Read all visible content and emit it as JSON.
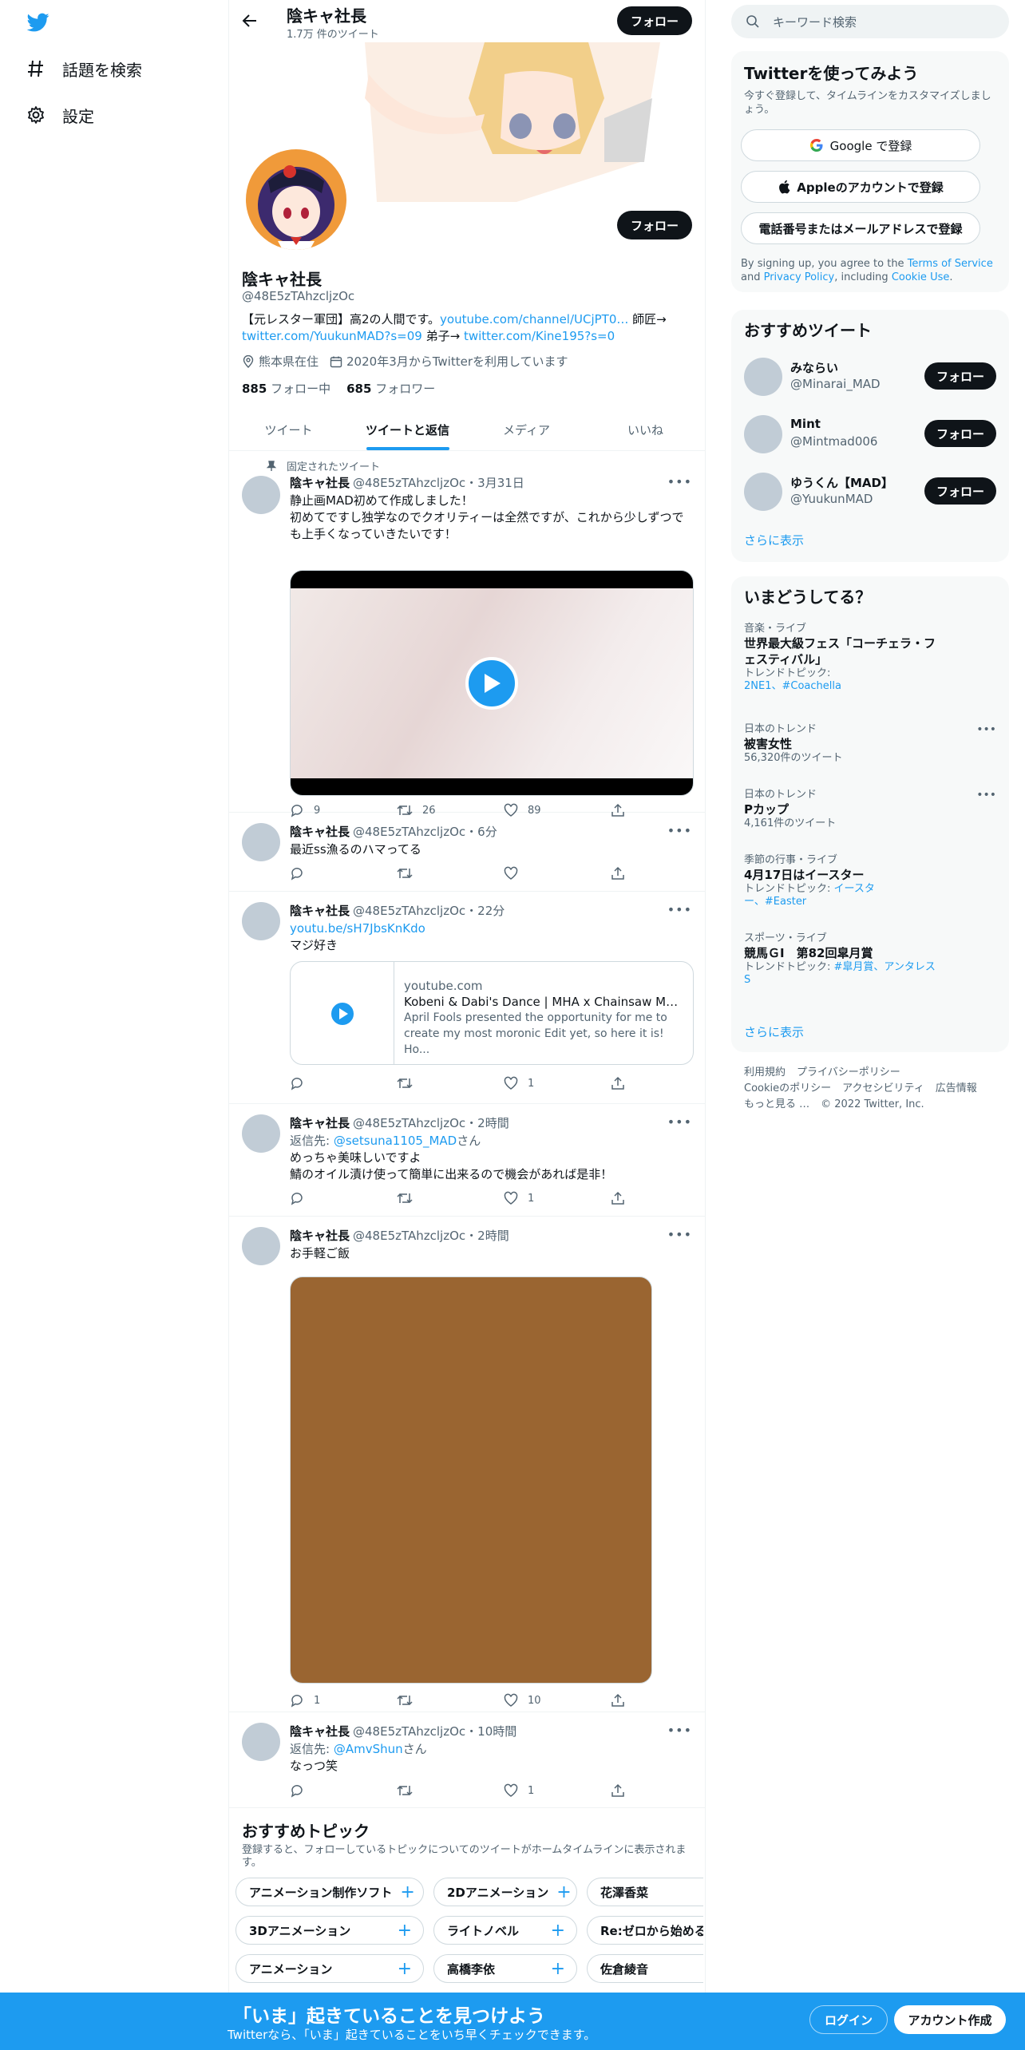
{
  "nav": {
    "explore_label": "話題を検索",
    "settings_label": "設定"
  },
  "header": {
    "name": "陰キャ社長",
    "tweet_count": "1.7万 件のツイート",
    "follow_label": "フォロー"
  },
  "profile": {
    "name": "陰キャ社長",
    "handle": "@48E5zTAhzcljzOc",
    "follow_label": "フォロー",
    "bio_text1": "【元レスター軍団】高2の人間です。",
    "bio_link1": "youtube.com/channel/UCjPT0…",
    "bio_text2": " 師匠→",
    "bio_link2": "twitter.com/YuukunMAD?s=09",
    "bio_text3": " 弟子→ ",
    "bio_link3": "twitter.com/Kine195?s=0",
    "location": "熊本県在住",
    "joined": "2020年3月からTwitterを利用しています",
    "following_count": "885",
    "following_label": "フォロー中",
    "followers_count": "685",
    "followers_label": "フォロワー"
  },
  "tabs": [
    "ツイート",
    "ツイートと返信",
    "メディア",
    "いいね"
  ],
  "tweets": [
    {
      "pinned_label": "固定されたツイート",
      "name": "陰キャ社長",
      "meta": "@48E5zTAhzcljzOc・3月31日",
      "text": "静止画MAD初めて作成しました！\n初めてですし独学なのでクオリティーは全然ですが、これから少しずつでも上手くなっていきたいです！",
      "replies": "9",
      "retweets": "26",
      "likes": "89"
    },
    {
      "name": "陰キャ社長",
      "meta": "@48E5zTAhzcljzOc・6分",
      "text": "最近ss漁るのハマってる",
      "replies": "",
      "retweets": "",
      "likes": ""
    },
    {
      "name": "陰キャ社長",
      "meta": "@48E5zTAhzcljzOc・22分",
      "link": "youtu.be/sH7JbsKnKdo",
      "text": "マジ好き",
      "card_domain": "youtube.com",
      "card_title": "Kobeni & Dabi's Dance | MHA x Chainsaw Man x ...",
      "card_desc": "April Fools presented the opportunity for me to create my most moronic Edit yet, so here it is! Ho...",
      "replies": "",
      "retweets": "",
      "likes": "1"
    },
    {
      "name": "陰キャ社長",
      "meta": "@48E5zTAhzcljzOc・2時間",
      "reply_to_label": "返信先: ",
      "reply_to": "@setsuna1105_MAD",
      "reply_suffix": "さん",
      "text": "めっちゃ美味しいですよ\n鯖のオイル漬け使って簡単に出来るので機会があれば是非！",
      "replies": "",
      "retweets": "",
      "likes": "1"
    },
    {
      "name": "陰キャ社長",
      "meta": "@48E5zTAhzcljzOc・2時間",
      "text": "お手軽ご飯",
      "replies": "1",
      "retweets": "",
      "likes": "10"
    },
    {
      "name": "陰キャ社長",
      "meta": "@48E5zTAhzcljzOc・10時間",
      "reply_to_label": "返信先: ",
      "reply_to": "@AmvShun",
      "reply_suffix": "さん",
      "text": "なっつ笑",
      "replies": "",
      "retweets": "",
      "likes": "1"
    }
  ],
  "topics": {
    "title": "おすすめトピック",
    "subtitle": "登録すると、フォローしているトピックについてのツイートがホームタイムラインに表示されます。",
    "rows": [
      [
        "アニメーション制作ソフト",
        "2Dアニメーション",
        "花澤香菜"
      ],
      [
        "3Dアニメーション",
        "ライトノベル",
        "Re:ゼロから始める"
      ],
      [
        "アニメーション",
        "高橋李依",
        "佐倉綾音"
      ]
    ]
  },
  "search": {
    "placeholder": "キーワード検索"
  },
  "signup": {
    "title": "Twitterを使ってみよう",
    "subtitle": "今すぐ登録して、タイムラインをカスタマイズしましょう。",
    "google": "Google で登録",
    "apple": "Appleのアカウントで登録",
    "phone": "電話番号またはメールアドレスで登録",
    "terms_1": "By signing up, you agree to the ",
    "terms_link1": "Terms of Service",
    "terms_2": " and ",
    "terms_link2": "Privacy Policy",
    "terms_3": ", including ",
    "terms_link3": "Cookie Use",
    "terms_4": "."
  },
  "suggest": {
    "title": "おすすめツイート",
    "users": [
      {
        "name": "みならい",
        "handle": "@Minarai_MAD"
      },
      {
        "name": "Mint",
        "handle": "@Mintmad006"
      },
      {
        "name": "ゆうくん【MAD】",
        "handle": "@YuukunMAD"
      }
    ],
    "follow_label": "フォロー",
    "more": "さらに表示"
  },
  "trends": {
    "title": "いまどうしてる？",
    "items": [
      {
        "cat": "音楽・ライブ",
        "title": "世界最大級フェス「コーチェラ・フェスティバル」",
        "sub_label": "トレンドトピック: ",
        "sub_links": "2NE1、#Coachella"
      },
      {
        "cat": "日本のトレンド",
        "title": "被害女性",
        "sub": "56,320件のツイート"
      },
      {
        "cat": "日本のトレンド",
        "title": "Pカップ",
        "sub": "4,161件のツイート"
      },
      {
        "cat": "季節の行事・ライブ",
        "title": "4月17日はイースター",
        "sub_label": "トレンドトピック: ",
        "sub_links": "イースター、#Easter"
      },
      {
        "cat": "スポーツ・ライブ",
        "title": "競馬ＧⅠ　第82回皐月賞",
        "sub_label": "トレンドトピック: ",
        "sub_links": "#皐月賞、アンタレスS"
      }
    ],
    "more": "さらに表示"
  },
  "footer": {
    "l1": "利用規約",
    "l2": "プライバシーポリシー",
    "l3": "Cookieのポリシー",
    "l4": "アクセシビリティ",
    "l5": "広告情報",
    "l6": "もっと見る …",
    "l7": "© 2022 Twitter, Inc."
  },
  "bottom": {
    "title": "「いま」起きていることを見つけよう",
    "subtitle": "Twitterなら、「いま」起きていることをいち早くチェックできます。",
    "login": "ログイン",
    "signup": "アカウント作成"
  },
  "colors": {
    "accent": "#1d9bf0",
    "text": "#0f1419",
    "secondary": "#536471"
  }
}
